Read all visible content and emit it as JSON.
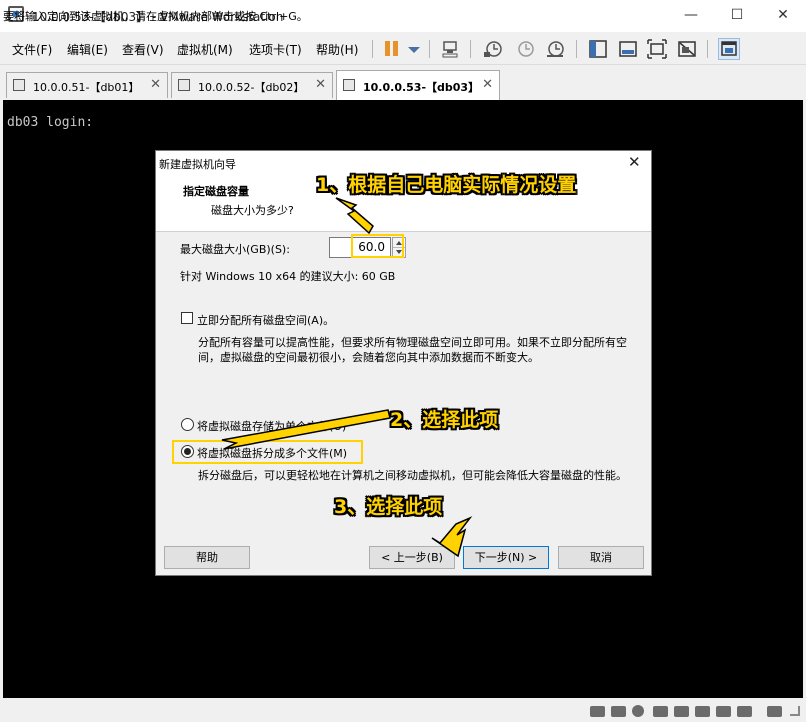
{
  "window": {
    "title": "10.0.0.53-【db03】 - VMware Workstation",
    "minimize": "—",
    "maximize": "☐",
    "close": "✕"
  },
  "menu": [
    "文件(F)",
    "编辑(E)",
    "查看(V)",
    "虚拟机(M)",
    "选项卡(T)",
    "帮助(H)"
  ],
  "tabs": [
    {
      "label": "10.0.0.51-【db01】",
      "close": "✕"
    },
    {
      "label": "10.0.0.52-【db02】",
      "close": "✕"
    },
    {
      "label": "10.0.0.53-【db03】",
      "close": "✕"
    }
  ],
  "console": {
    "text": "db03 login:"
  },
  "dialog": {
    "title": "新建虚拟机向导",
    "close": "✕",
    "heading": "指定磁盘容量",
    "subheading": "磁盘大小为多少?",
    "max_size_label": "最大磁盘大小(GB)(S):",
    "max_size_value": "60.0",
    "recommendation": "针对 Windows 10 x64 的建议大小: 60 GB",
    "allocate_label": "立即分配所有磁盘空间(A)。",
    "allocate_desc": "分配所有容量可以提高性能，但要求所有物理磁盘空间立即可用。如果不立即分配所有空间，虚拟磁盘的空间最初很小，会随着您向其中添加数据而不断变大。",
    "single_file_label": "将虚拟磁盘存储为单个文件(O)",
    "multi_file_label": "将虚拟磁盘拆分成多个文件(M)",
    "multi_file_desc": "拆分磁盘后，可以更轻松地在计算机之间移动虚拟机，但可能会降低大容量磁盘的性能。",
    "buttons": {
      "help": "帮助",
      "back": "< 上一步(B)",
      "next": "下一步(N) >",
      "cancel": "取消"
    }
  },
  "annotations": {
    "step1": "1、根据自己电脑实际情况设置",
    "step2": "2、选择此项",
    "step3": "3、选择此项"
  },
  "statusbar": {
    "text": "要将输入定向到该虚拟机，请在虚拟机内部单击或按 Ctrl+G。"
  },
  "colors": {
    "annotation": "#ffd200",
    "console_bg": "#000000",
    "accent": "#0078d7",
    "pause": "#e8922c"
  }
}
